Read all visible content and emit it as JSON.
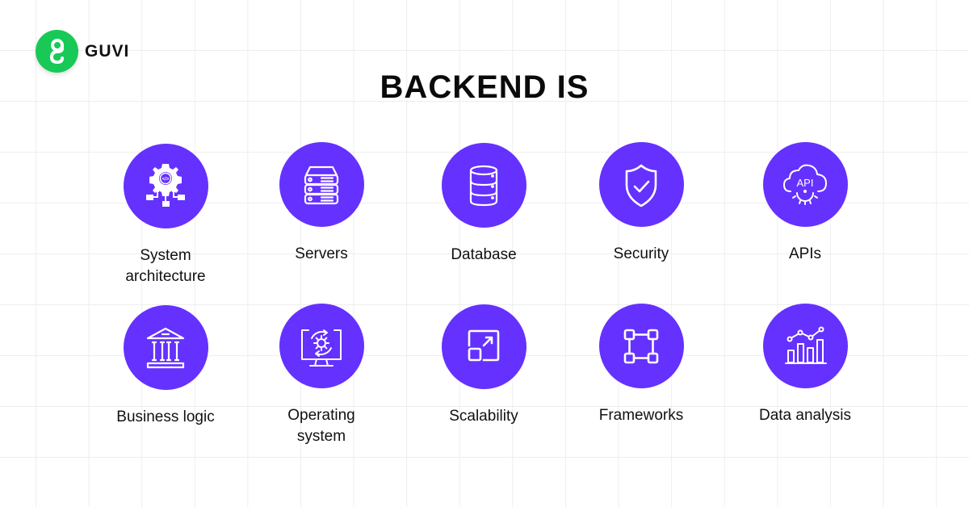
{
  "brand": {
    "name": "GUVI",
    "icon": "guvi-logo-icon",
    "color": "#18C957"
  },
  "title": "BACKEND IS",
  "accent_color": "#6531FF",
  "items": [
    {
      "label": "System architecture",
      "icon": "system-architecture-icon"
    },
    {
      "label": "Servers",
      "icon": "server-icon"
    },
    {
      "label": "Database",
      "icon": "database-icon"
    },
    {
      "label": "Security",
      "icon": "shield-check-icon"
    },
    {
      "label": "APIs",
      "icon": "api-cloud-icon"
    },
    {
      "label": "Business logic",
      "icon": "institution-icon"
    },
    {
      "label": "Operating system",
      "icon": "monitor-gear-icon"
    },
    {
      "label": "Scalability",
      "icon": "scale-up-icon"
    },
    {
      "label": "Frameworks",
      "icon": "framework-nodes-icon"
    },
    {
      "label": "Data analysis",
      "icon": "chart-analysis-icon"
    }
  ]
}
